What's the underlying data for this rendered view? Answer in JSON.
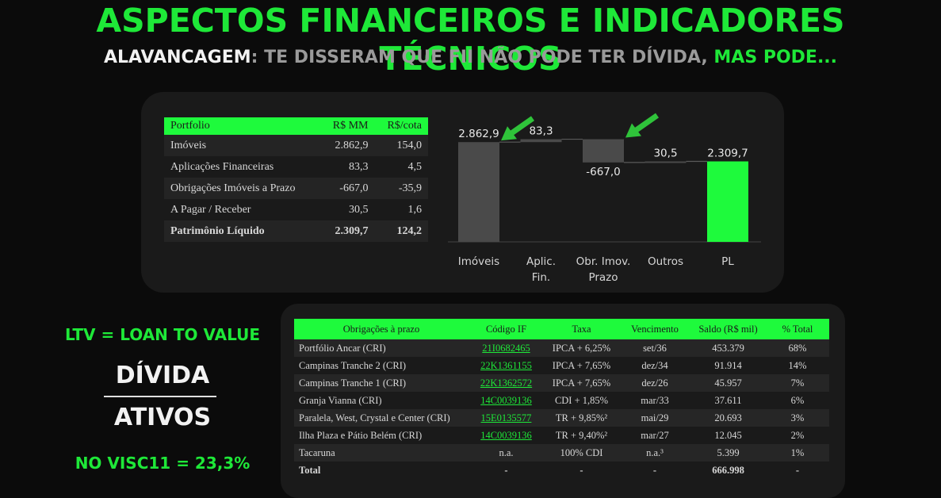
{
  "header": {
    "title": "ASPECTOS FINANCEIROS E INDICADORES TÉCNICOS",
    "subtitle_part1": "ALAVANCAGEM",
    "subtitle_part2": ": TE DISSERAM QUE FII NÃO PODE TER DÍVIDA, ",
    "subtitle_part3": "MAS PODE..."
  },
  "portfolio_table": {
    "headers": [
      "Portfolio",
      "R$ MM",
      "R$/cota"
    ],
    "rows": [
      {
        "label": "Imóveis",
        "mm": "2.862,9",
        "cota": "154,0"
      },
      {
        "label": "Aplicações Financeiras",
        "mm": "83,3",
        "cota": "4,5"
      },
      {
        "label": "Obrigações Imóveis a Prazo",
        "mm": "-667,0",
        "cota": "-35,9"
      },
      {
        "label": "A Pagar / Receber",
        "mm": "30,5",
        "cota": "1,6"
      },
      {
        "label": "Patrimônio Líquido",
        "mm": "2.309,7",
        "cota": "124,2"
      }
    ]
  },
  "chart_data": {
    "type": "bar",
    "subtype": "waterfall",
    "categories": [
      "Imóveis",
      "Aplic. Fin.",
      "Obr. Imov. Prazo",
      "Outros",
      "PL"
    ],
    "category_lines": [
      [
        "Imóveis"
      ],
      [
        "Aplic.",
        "Fin."
      ],
      [
        "Obr. Imov.",
        "Prazo"
      ],
      [
        "Outros"
      ],
      [
        "PL"
      ]
    ],
    "values": [
      2862.9,
      83.3,
      -667.0,
      30.5,
      2309.7
    ],
    "value_labels": [
      "2.862,9",
      "83,3",
      "-667,0",
      "30,5",
      "2.309,7"
    ],
    "kinds": [
      "total",
      "delta",
      "delta",
      "delta",
      "total"
    ],
    "ylim": [
      0,
      3300
    ],
    "colors": {
      "bar": "#4a4a4a",
      "final": "#1efa3c",
      "arrow": "#2fc33a",
      "connector": "#5a5a5a"
    },
    "arrows_on": [
      "Imóveis",
      "Obr. Imov. Prazo"
    ]
  },
  "ltv": {
    "title": "LTV = LOAN TO VALUE",
    "numerator": "DÍVIDA",
    "denominator": "ATIVOS",
    "result": "NO VISC11 = 23,3%"
  },
  "obligations_table": {
    "headers": [
      "Obrigações à prazo",
      "Código IF",
      "Taxa",
      "Vencimento",
      "Saldo (R$ mil)",
      "% Total"
    ],
    "rows": [
      [
        "Portfólio Ancar (CRI)",
        "21I0682465",
        "IPCA + 6,25%",
        "set/36",
        "453.379",
        "68%"
      ],
      [
        "Campinas Tranche 2 (CRI)",
        "22K1361155",
        "IPCA + 7,65%",
        "dez/34",
        "91.914",
        "14%"
      ],
      [
        "Campinas Tranche 1 (CRI)",
        "22K1362572",
        "IPCA + 7,65%",
        "dez/26",
        "45.957",
        "7%"
      ],
      [
        "Granja Vianna (CRI)",
        "14C0039136",
        "CDI + 1,85%",
        "mar/33",
        "37.611",
        "6%"
      ],
      [
        "Paralela, West, Crystal e Center (CRI)",
        "15E0135577",
        "TR + 9,85%²",
        "mai/29",
        "20.693",
        "3%"
      ],
      [
        "Ilha Plaza e Pátio Belém (CRI)",
        "14C0039136",
        "TR + 9,40%²",
        "mar/27",
        "12.045",
        "2%"
      ],
      [
        "Tacaruna",
        "n.a.",
        "100% CDI",
        "n.a.³",
        "5.399",
        "1%"
      ],
      [
        "Total",
        "-",
        "-",
        "-",
        "666.998",
        "-"
      ]
    ]
  }
}
